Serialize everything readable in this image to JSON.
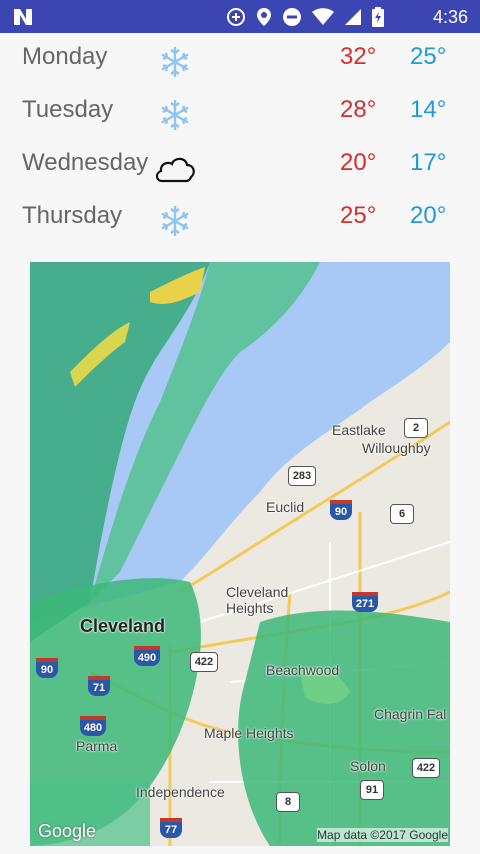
{
  "status_bar": {
    "time": "4:36",
    "icons": [
      "n-logo-icon",
      "data-saver-icon",
      "location-icon",
      "do-not-disturb-icon",
      "wifi-icon",
      "signal-icon",
      "battery-charging-icon"
    ]
  },
  "forecast": [
    {
      "day": "Monday",
      "icon": "snowflake-icon",
      "high": "32°",
      "low": "25°"
    },
    {
      "day": "Tuesday",
      "icon": "snowflake-icon",
      "high": "28°",
      "low": "14°"
    },
    {
      "day": "Wednesday",
      "icon": "cloud-icon",
      "high": "20°",
      "low": "17°"
    },
    {
      "day": "Thursday",
      "icon": "snowflake-icon",
      "high": "25°",
      "low": "20°"
    }
  ],
  "colors": {
    "high": "#d32f2f",
    "low": "#1e9bd7",
    "statusbar": "#3b46b2",
    "radar": "#3cb878",
    "lake": "#a8c8f5"
  },
  "map": {
    "labels": {
      "eastlake": "Eastlake",
      "willoughby": "Willoughby",
      "euclid": "Euclid",
      "cleveland_heights": "Cleveland\nHeights",
      "cleveland": "Cleveland",
      "beachwood": "Beachwood",
      "chagrin": "Chagrin Fal",
      "maple_heights": "Maple Heights",
      "parma": "Parma",
      "solon": "Solon",
      "independence": "Independence"
    },
    "shields": {
      "r2": "2",
      "r283": "283",
      "i90a": "90",
      "r6": "6",
      "i271": "271",
      "i90b": "90",
      "i490": "490",
      "r422a": "422",
      "i71": "71",
      "i480": "480",
      "r422b": "422",
      "r91": "91",
      "r8": "8",
      "i77": "77"
    },
    "google_logo": "Google",
    "attribution": "Map data ©2017 Google"
  }
}
